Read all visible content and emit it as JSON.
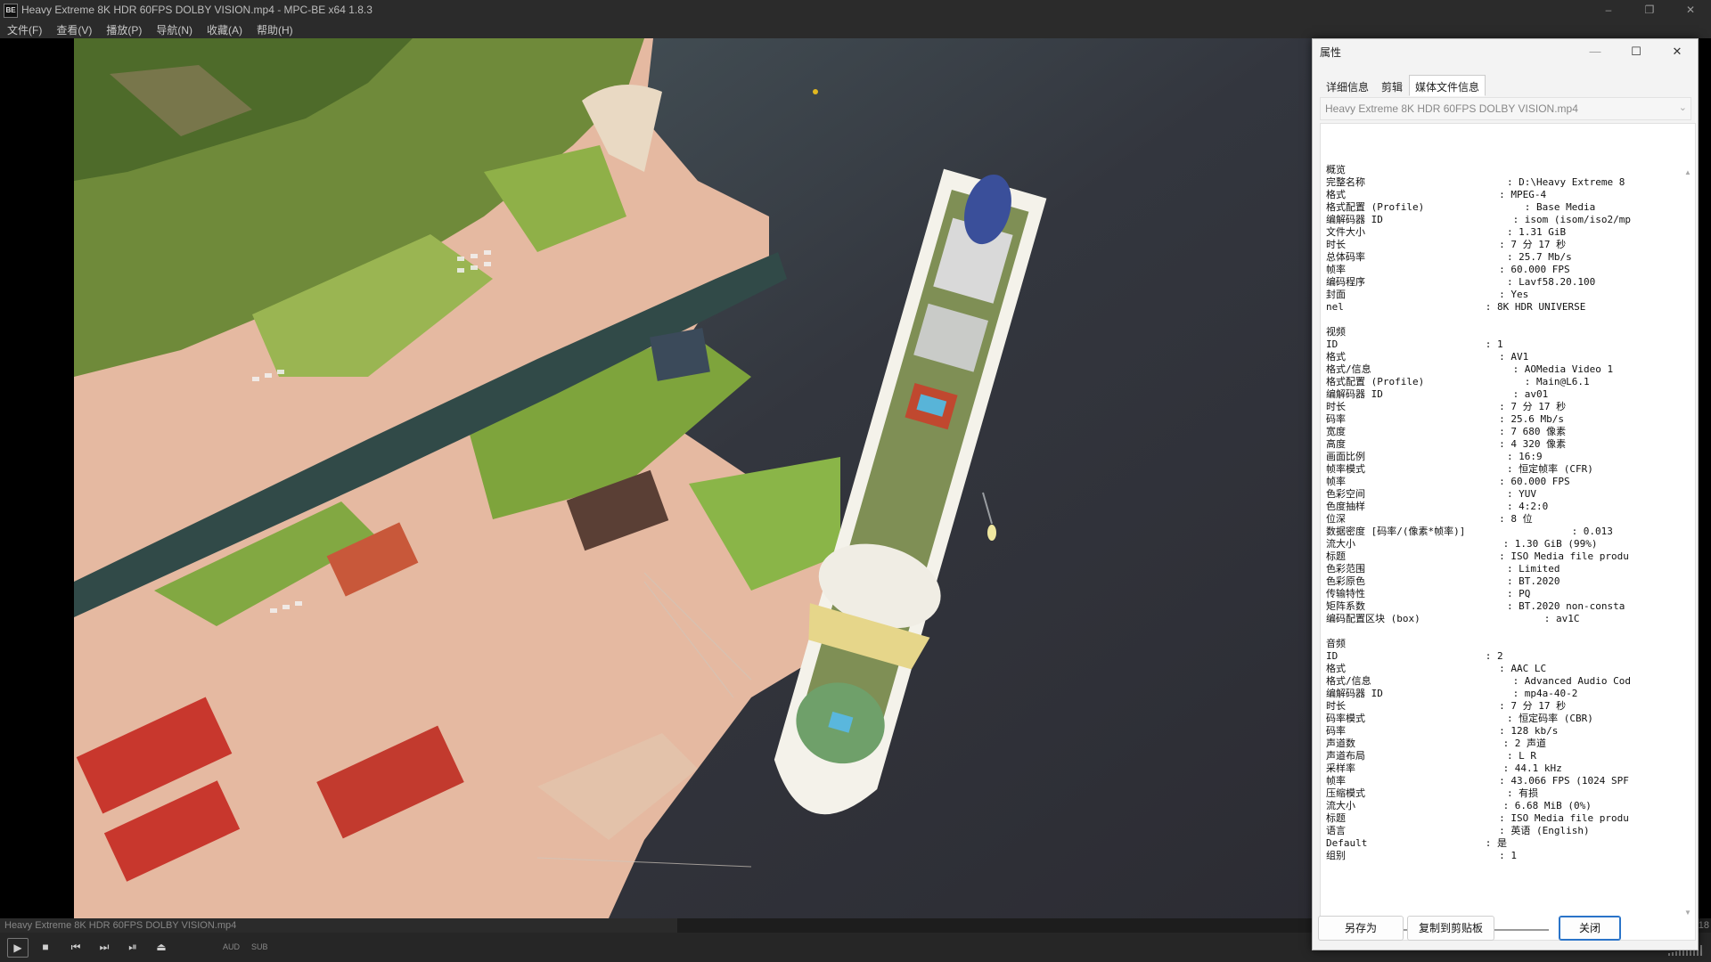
{
  "window": {
    "title": "Heavy Extreme 8K HDR 60FPS DOLBY VISION.mp4 - MPC-BE x64 1.8.3",
    "app_icon_text": "BE",
    "controls": [
      "–",
      "❐",
      "✕"
    ]
  },
  "menu": [
    "文件(F)",
    "查看(V)",
    "播放(P)",
    "导航(N)",
    "收藏(A)",
    "帮助(H)"
  ],
  "player": {
    "status_file": "Heavy Extreme 8K HDR 60FPS DOLBY VISION.mp4",
    "status_count": "18",
    "progress_fraction": 0.396,
    "labels": {
      "audio": "AUD",
      "subtitle": "SUB"
    },
    "buttons": {
      "play": "▶",
      "stop": "■",
      "prev": "⏮",
      "next": "⏭",
      "frame_step": "⏯",
      "eject": "⏏"
    }
  },
  "dialog": {
    "title": "属性",
    "window_controls": {
      "minimize": "—",
      "maximize": "☐",
      "close": "✕"
    },
    "tabs": [
      "详细信息",
      "剪辑",
      "媒体文件信息"
    ],
    "active_tab": 2,
    "file_selector": {
      "value": "Heavy Extreme 8K HDR 60FPS DOLBY VISION.mp4"
    },
    "info_lines": [
      "概览",
      "完整名称                        : D:\\Heavy Extreme 8",
      "格式                          : MPEG-4",
      "格式配置 (Profile)                 : Base Media",
      "编解码器 ID                      : isom (isom/iso2/mp",
      "文件大小                        : 1.31 GiB",
      "时长                          : 7 分 17 秒",
      "总体码率                        : 25.7 Mb/s",
      "帧率                          : 60.000 FPS",
      "编码程序                        : Lavf58.20.100",
      "封面                          : Yes",
      "nel                        : 8K HDR UNIVERSE",
      "",
      "视频",
      "ID                         : 1",
      "格式                          : AV1",
      "格式/信息                        : AOMedia Video 1",
      "格式配置 (Profile)                 : Main@L6.1",
      "编解码器 ID                      : av01",
      "时长                          : 7 分 17 秒",
      "码率                          : 25.6 Mb/s",
      "宽度                          : 7 680 像素",
      "高度                          : 4 320 像素",
      "画面比例                        : 16:9",
      "帧率模式                        : 恒定帧率 (CFR)",
      "帧率                          : 60.000 FPS",
      "色彩空间                        : YUV",
      "色度抽样                        : 4:2:0",
      "位深                          : 8 位",
      "数据密度 [码率/(像素*帧率)]                  : 0.013",
      "流大小                         : 1.30 GiB (99%)",
      "标题                          : ISO Media file produ",
      "色彩范围                        : Limited",
      "色彩原色                        : BT.2020",
      "传输特性                        : PQ",
      "矩阵系数                        : BT.2020 non-consta",
      "编码配置区块 (box)                     : av1C",
      "",
      "音频",
      "ID                         : 2",
      "格式                          : AAC LC",
      "格式/信息                        : Advanced Audio Cod",
      "编解码器 ID                      : mp4a-40-2",
      "时长                          : 7 分 17 秒",
      "码率模式                        : 恒定码率 (CBR)",
      "码率                          : 128 kb/s",
      "声道数                         : 2 声道",
      "声道布局                        : L R",
      "采样率                         : 44.1 kHz",
      "帧率                          : 43.066 FPS (1024 SPF",
      "压缩模式                        : 有损",
      "流大小                         : 6.68 MiB (0%)",
      "标题                          : ISO Media file produ",
      "语言                          : 英语 (English)",
      "Default                    : 是",
      "组别                          : 1"
    ],
    "buttons": {
      "save_as": "另存为",
      "copy": "复制到剪贴板",
      "close": "关闭"
    }
  },
  "colors": {
    "water": "#3b3d45",
    "grass": "#7aa342",
    "roof_red": "#c8372d",
    "pavement": "#e8c8b4",
    "accent_blue": "#2a74c9"
  }
}
